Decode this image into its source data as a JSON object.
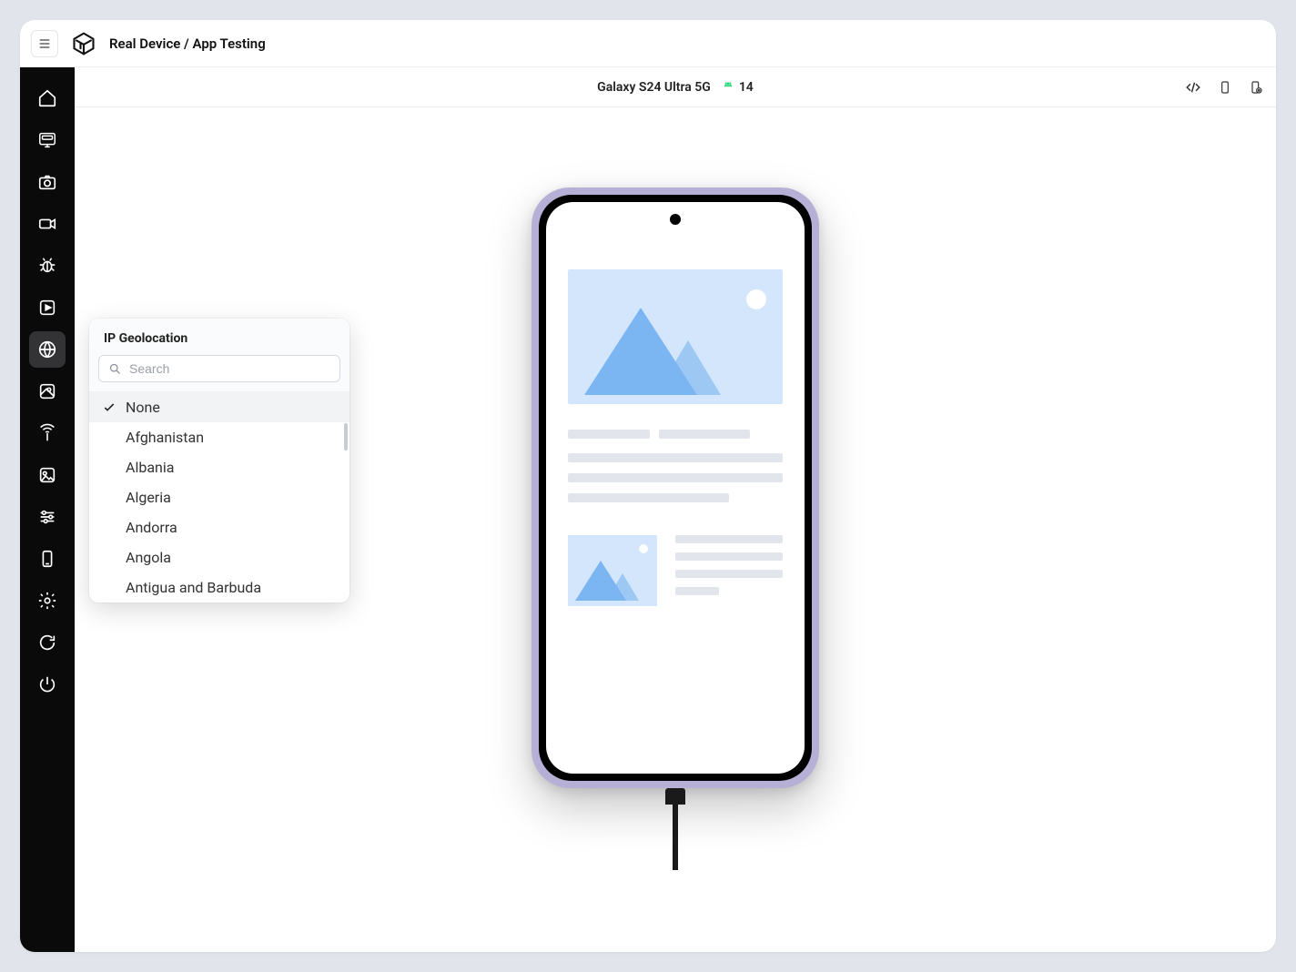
{
  "header": {
    "breadcrumb": "Real Device / App Testing"
  },
  "device_bar": {
    "device_name": "Galaxy S24 Ultra 5G",
    "os_version": "14"
  },
  "popup": {
    "title": "IP Geolocation",
    "search_placeholder": "Search",
    "items": [
      {
        "label": "None",
        "selected": true
      },
      {
        "label": "Afghanistan",
        "selected": false
      },
      {
        "label": "Albania",
        "selected": false
      },
      {
        "label": "Algeria",
        "selected": false
      },
      {
        "label": "Andorra",
        "selected": false
      },
      {
        "label": "Angola",
        "selected": false
      },
      {
        "label": "Antigua and Barbuda",
        "selected": false
      }
    ]
  },
  "sidebar_icons": [
    "home",
    "app",
    "camera",
    "video",
    "bug",
    "play",
    "globe",
    "map-pin",
    "antenna",
    "image",
    "sliders",
    "phone",
    "gear",
    "refresh",
    "power"
  ]
}
